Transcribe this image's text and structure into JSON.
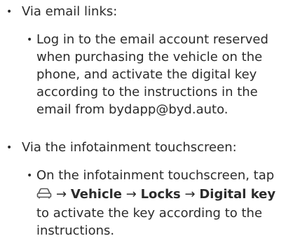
{
  "items": [
    {
      "label": "Via email links:",
      "sub": {
        "lines": [
          "Log in to the email account reserved",
          "when purchasing the vehicle on the",
          "phone, and activate the digital key",
          "according to the instructions in the",
          "email from bydapp@byd.auto."
        ]
      }
    },
    {
      "label": "Via the infotainment touchscreen:",
      "sub": {
        "line1": "On the infotainment touchscreen, tap",
        "icon": "car-icon",
        "arrow": "→",
        "vehicle": "Vehicle",
        "locks": "Locks",
        "digital_key": "Digital key",
        "lines_after": [
          "to activate the key according to the",
          "instructions."
        ]
      }
    }
  ]
}
